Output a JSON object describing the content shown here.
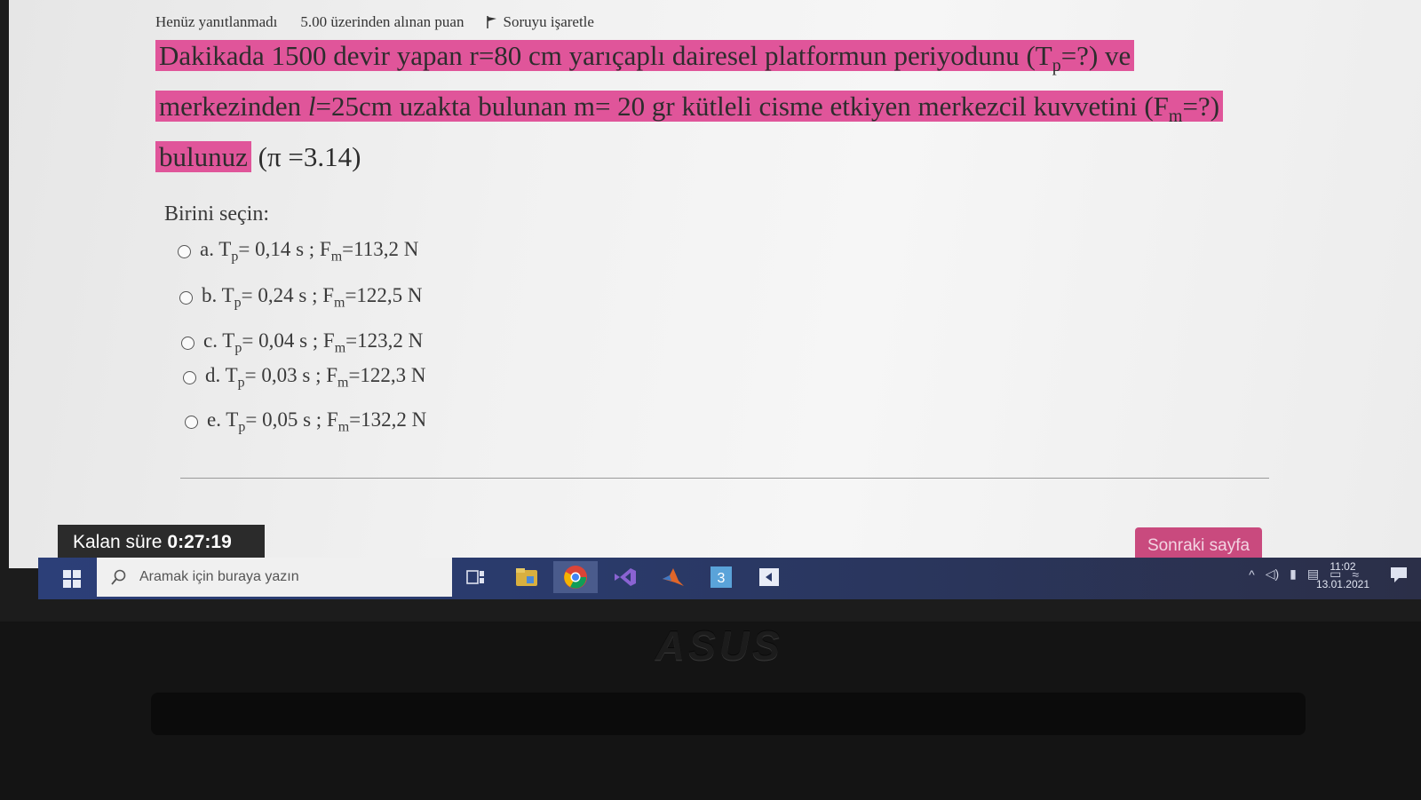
{
  "header": {
    "status": "Henüz yanıtlanmadı",
    "points": "5.00 üzerinden alınan puan",
    "flag_label": "Soruyu işaretle"
  },
  "question": {
    "part1": "Dakikada 1500 devir yapan  r=80 cm  yarıçaplı dairesel platformun periyodunu (T",
    "sub_p": "p",
    "part2": "=?) ve merkezinden  ",
    "l_var": "l",
    "part3": "=25cm uzakta bulunan  m= 20 gr kütleli cisme etkiyen merkezcil kuvvetini (F",
    "sub_m": "m",
    "part4": "=?) bulunuz",
    "pi_note": "(π =3.14)"
  },
  "prompt": "Birini seçin:",
  "options": [
    {
      "letter": "a. T",
      "sub1": "p",
      "tp": "= 0,14 s  ;  F",
      "sub2": "m",
      "fm": "=113,2 N"
    },
    {
      "letter": "b. T",
      "sub1": "p",
      "tp": "= 0,24 s  ;  F",
      "sub2": "m",
      "fm": "=122,5 N"
    },
    {
      "letter": "c. T",
      "sub1": "p",
      "tp": "= 0,04 s   ;  F",
      "sub2": "m",
      "fm": "=123,2 N"
    },
    {
      "letter": "d. T",
      "sub1": "p",
      "tp": "= 0,03 s ;  F",
      "sub2": "m",
      "fm": "=122,3 N"
    },
    {
      "letter": "e. T",
      "sub1": "p",
      "tp": "= 0,05 s  ;  F",
      "sub2": "m",
      "fm": "=132,2 N"
    }
  ],
  "timer": {
    "label": "Kalan süre",
    "value": "0:27:19"
  },
  "next_button": "Sonraki sayfa",
  "taskbar": {
    "search_placeholder": "Aramak için buraya yazın",
    "time": "11:02",
    "date": "13.01.2021"
  },
  "brand": "ASUS"
}
